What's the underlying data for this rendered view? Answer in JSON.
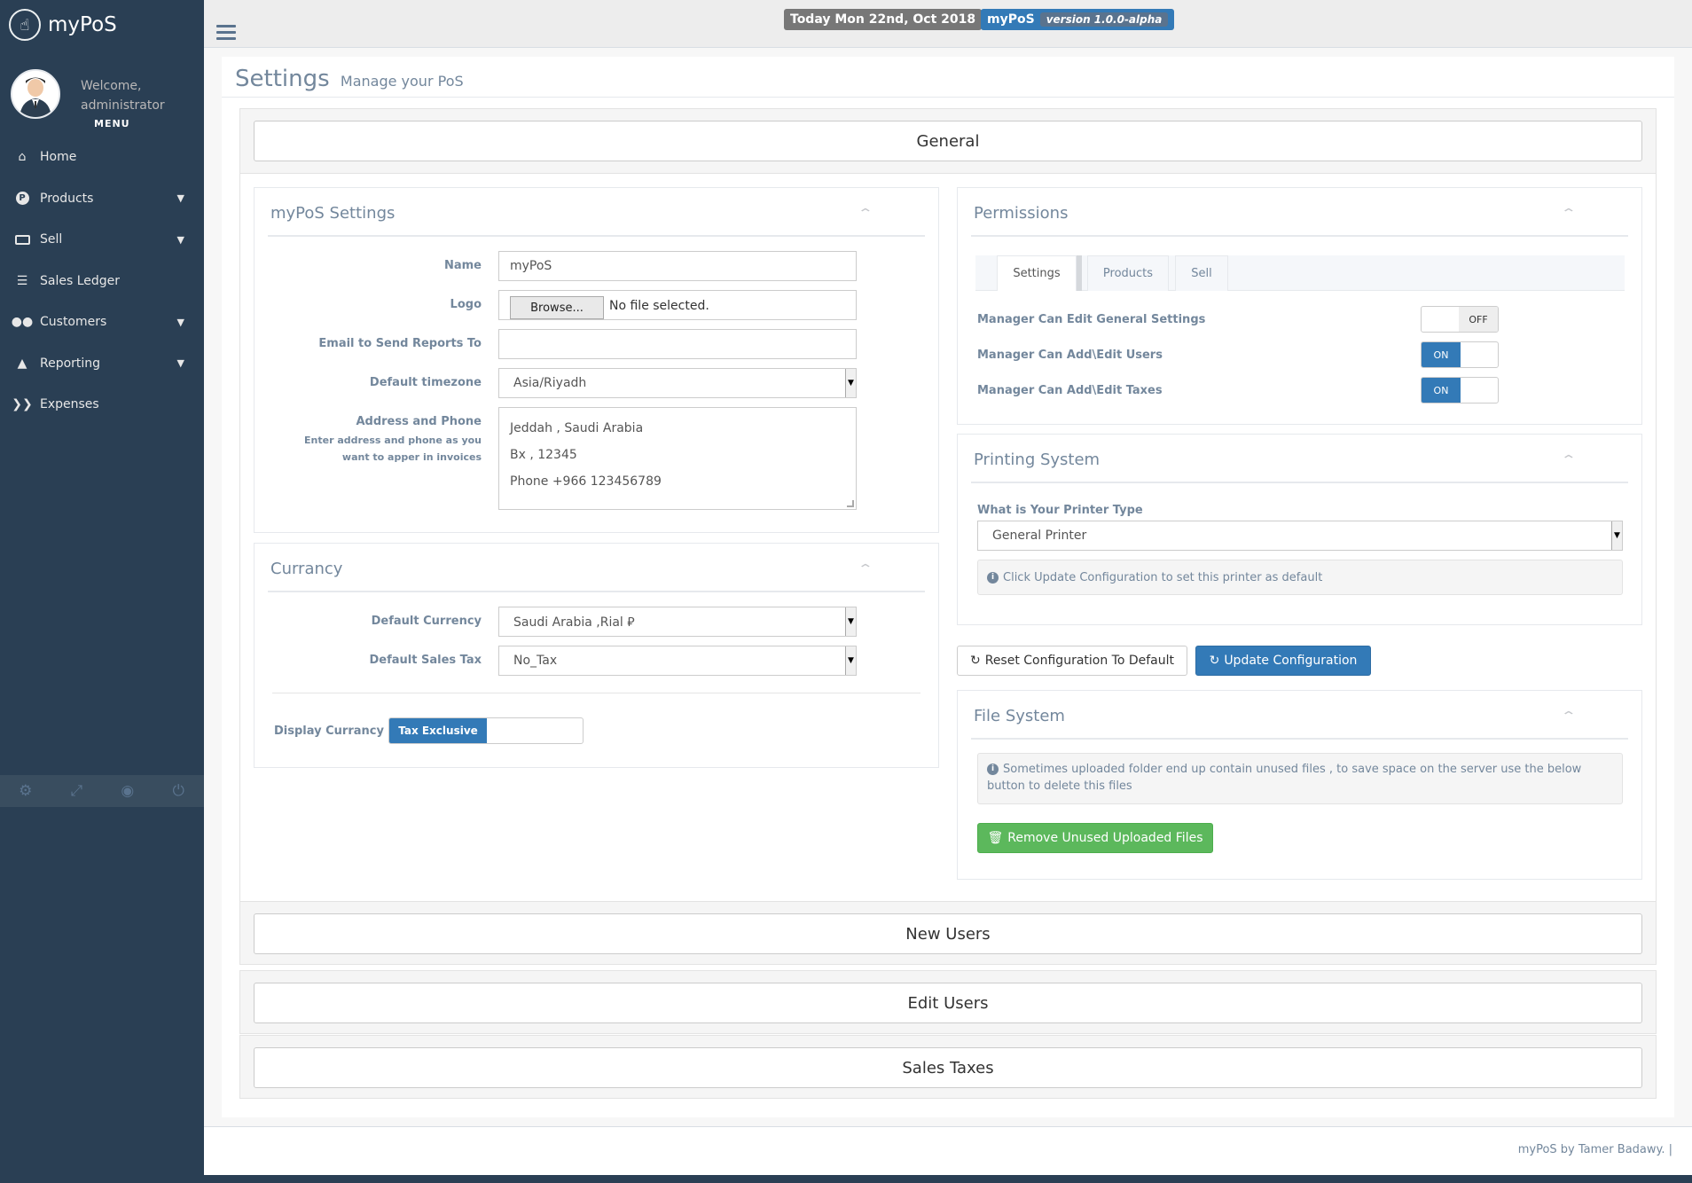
{
  "app": {
    "title": "myPoS"
  },
  "sidebar": {
    "welcome": "Welcome,",
    "username": "administrator",
    "menu_label": "MENU",
    "items": [
      {
        "label": "Home",
        "icon": "home-icon"
      },
      {
        "label": "Products",
        "icon": "products-icon"
      },
      {
        "label": "Sell",
        "icon": "money-icon"
      },
      {
        "label": "Sales Ledger",
        "icon": "database-icon"
      },
      {
        "label": "Customers",
        "icon": "users-icon"
      },
      {
        "label": "Reporting",
        "icon": "chart-icon"
      },
      {
        "label": "Expenses",
        "icon": "expenses-icon"
      }
    ],
    "footer_icons": [
      "gear-icon",
      "fullscreen-icon",
      "globe-icon",
      "power-icon"
    ]
  },
  "topbar": {
    "date": "Today Mon 22nd, Oct 2018",
    "app_name": "myPoS",
    "version": "version 1.0.0-alpha"
  },
  "page": {
    "title": "Settings",
    "subtitle": "Manage your PoS"
  },
  "accordion": {
    "general": "General",
    "new_users": "New Users",
    "edit_users": "Edit Users",
    "sales_taxes": "Sales Taxes"
  },
  "mypos_settings": {
    "title": "myPoS Settings",
    "name_label": "Name",
    "name_value": "myPoS",
    "logo_label": "Logo",
    "browse_label": "Browse...",
    "no_file": "No file selected.",
    "email_label": "Email to Send Reports To",
    "email_value": "",
    "timezone_label": "Default timezone",
    "timezone_value": "Asia/Riyadh",
    "address_label": "Address and Phone",
    "address_help": "Enter address and phone as you want to apper in invoices",
    "address_lines": [
      "Jeddah , Saudi Arabia",
      "Bx , 12345",
      "Phone +966 123456789"
    ]
  },
  "currency": {
    "title": "Currancy",
    "default_currency_label": "Default Currency",
    "default_currency_value": "Saudi Arabia ,Rial ⃁",
    "default_tax_label": "Default Sales Tax",
    "default_tax_value": "No_Tax",
    "display_label": "Display Currancy",
    "display_value": "Tax Exclusive"
  },
  "permissions": {
    "title": "Permissions",
    "tabs": [
      "Settings",
      "Products",
      "Sell"
    ],
    "rows": [
      {
        "label": "Manager Can Edit General Settings",
        "state": "OFF"
      },
      {
        "label": "Manager Can Add\\Edit Users",
        "state": "ON"
      },
      {
        "label": "Manager Can Add\\Edit Taxes",
        "state": "ON"
      }
    ]
  },
  "printing": {
    "title": "Printing System",
    "type_label": "What is Your Printer Type",
    "type_value": "General Printer",
    "info": "Click Update Configuration to set this printer as default"
  },
  "config_buttons": {
    "reset": "Reset Configuration To Default",
    "update": "Update Configuration"
  },
  "file_system": {
    "title": "File System",
    "info": "Sometimes uploaded folder end up contain unused files , to save space on the server use the below button to delete this files",
    "remove_button": "Remove Unused Uploaded Files"
  },
  "footer": {
    "text": "myPoS by Tamer Badawy. |"
  },
  "colors": {
    "sidebar_bg": "#2a3f54",
    "primary": "#337ab7",
    "success": "#5cb85c",
    "muted_text": "#73879c"
  }
}
